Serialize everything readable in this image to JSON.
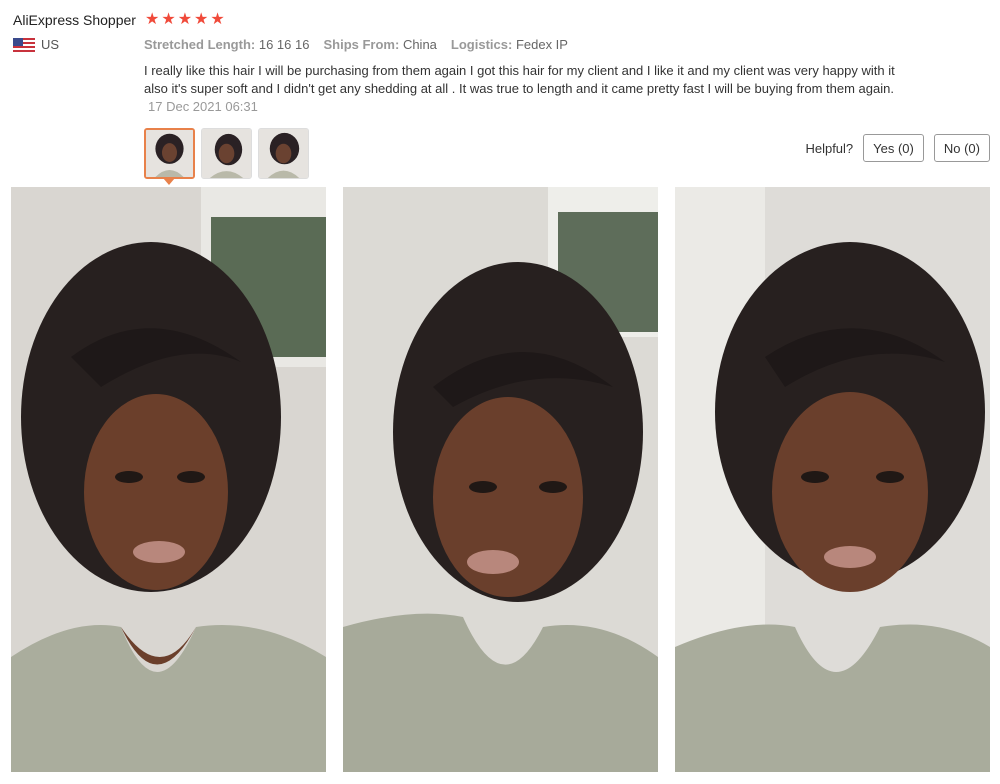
{
  "reviewer": {
    "name": "AliExpress Shopper",
    "rating": 5,
    "country": "US"
  },
  "icons": {
    "star": "star-icon",
    "flag": "us-flag-icon"
  },
  "colors": {
    "star": "#f04a3a",
    "active_thumb": "#e8814a"
  },
  "attributes": [
    {
      "key": "Stretched Length:",
      "value": "16 16 16"
    },
    {
      "key": "Ships From:",
      "value": "China"
    },
    {
      "key": "Logistics:",
      "value": "Fedex IP"
    }
  ],
  "review": {
    "text": "I really like this hair I will be purchasing from them again I got this hair for my client and I like it and my client was very happy with it also it's super soft and I didn't get any shedding at all . It was true to length and it came pretty fast I will be buying from them again.",
    "date": "17 Dec 2021 06:31"
  },
  "helpful": {
    "label": "Helpful?",
    "yes": "Yes (0)",
    "no": "No (0)"
  }
}
